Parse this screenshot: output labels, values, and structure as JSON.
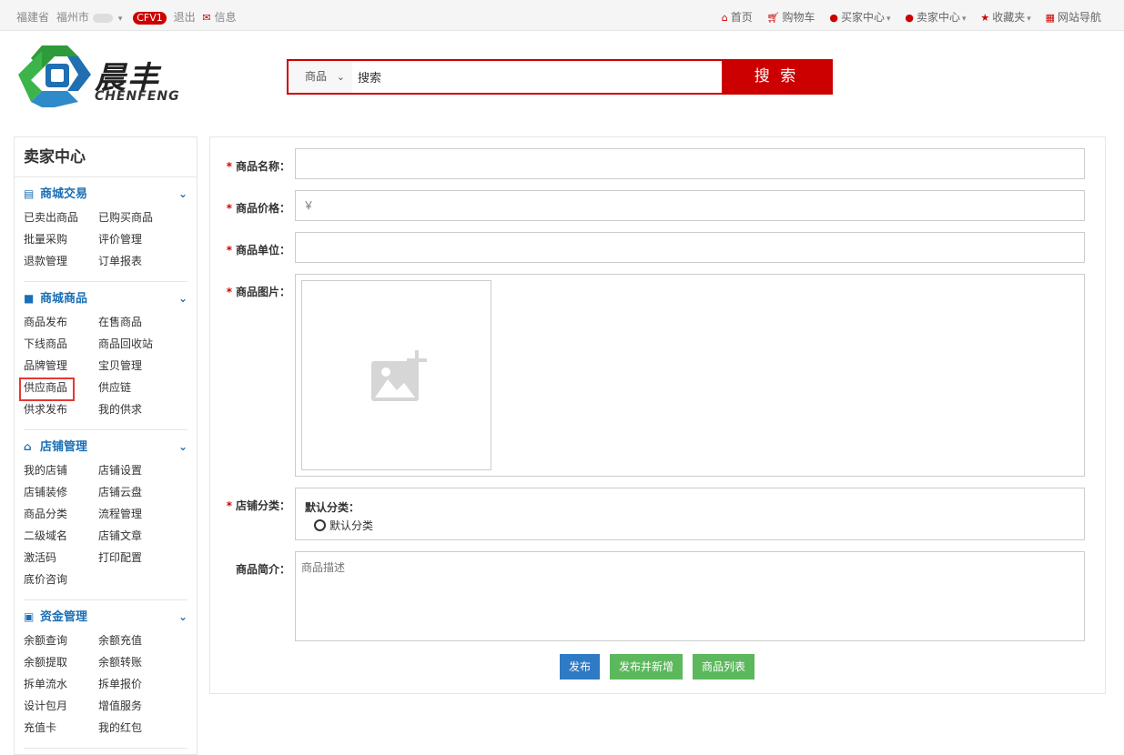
{
  "topbar": {
    "province": "福建省",
    "city": "福州市",
    "badge": "CFV1",
    "logout": "退出",
    "messages": "信息",
    "links": {
      "home": "首页",
      "cart": "购物车",
      "buyer_center": "买家中心",
      "seller_center": "卖家中心",
      "favorites": "收藏夹",
      "site_nav": "网站导航"
    }
  },
  "logo": {
    "cn": "晨丰",
    "en": "CHENFENG"
  },
  "search": {
    "category": "商品",
    "value": "搜索",
    "button": "搜 索"
  },
  "sidebar": {
    "title": "卖家中心",
    "groups": [
      {
        "name": "商城交易",
        "icon": "list-icon",
        "items": [
          "已卖出商品",
          "已购买商品",
          "批量采购",
          "评价管理",
          "退款管理",
          "订单报表"
        ]
      },
      {
        "name": "商城商品",
        "icon": "truck-icon",
        "items": [
          "商品发布",
          "在售商品",
          "下线商品",
          "商品回收站",
          "品牌管理",
          "宝贝管理",
          "供应商品",
          "供应链",
          "供求发布",
          "我的供求"
        ]
      },
      {
        "name": "店铺管理",
        "icon": "home-icon",
        "items": [
          "我的店铺",
          "店铺设置",
          "店铺装修",
          "店铺云盘",
          "商品分类",
          "流程管理",
          "二级域名",
          "店铺文章",
          "激活码",
          "打印配置",
          "底价咨询"
        ]
      },
      {
        "name": "资金管理",
        "icon": "money-icon",
        "items": [
          "余额查询",
          "余额充值",
          "余额提取",
          "余额转账",
          "拆单流水",
          "拆单报价",
          "设计包月",
          "增值服务",
          "充值卡",
          "我的红包"
        ]
      }
    ]
  },
  "form": {
    "name_label": "商品名称：",
    "price_label": "商品价格：",
    "price_placeholder": "￥",
    "unit_label": "商品单位：",
    "image_label": "商品图片：",
    "shop_category_label": "店铺分类：",
    "default_category_title": "默认分类：",
    "default_category_option": "默认分类",
    "intro_label": "商品简介：",
    "intro_placeholder": "商品描述",
    "required_mark": "*"
  },
  "actions": {
    "publish": "发布",
    "publish_new": "发布并新增",
    "list": "商品列表"
  },
  "colors": {
    "brand_red": "#cc0000",
    "link_blue": "#1a6fb5",
    "btn_blue": "#2f7ac4",
    "btn_green": "#5cb85c"
  }
}
